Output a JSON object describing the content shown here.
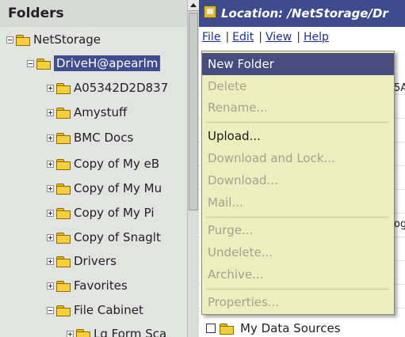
{
  "tree": {
    "title": "Folders",
    "items": [
      {
        "label": "NetStorage",
        "state": "minus"
      },
      {
        "label": "DriveH@apearlm",
        "state": "minus"
      },
      {
        "label": "A05342D2D837",
        "state": "plus"
      },
      {
        "label": "Amystuff",
        "state": "plus"
      },
      {
        "label": "BMC Docs",
        "state": "plus"
      },
      {
        "label": "Copy of My eB",
        "state": "plus"
      },
      {
        "label": "Copy of My Mu",
        "state": "plus"
      },
      {
        "label": "Copy of My Pi",
        "state": "plus"
      },
      {
        "label": "Copy of Snaglt",
        "state": "plus"
      },
      {
        "label": "Drivers",
        "state": "plus"
      },
      {
        "label": "Favorites",
        "state": "plus"
      },
      {
        "label": "File Cabinet",
        "state": "minus"
      },
      {
        "label": "Lg Form Sca",
        "state": "plus"
      }
    ]
  },
  "location": {
    "text": "Location: /NetStorage/Dr"
  },
  "menubar": {
    "file": "File",
    "edit": "Edit",
    "view": "View",
    "help": "Help",
    "separator": "|"
  },
  "file_menu": {
    "items": [
      {
        "label": "New Folder",
        "state": "highlighted"
      },
      {
        "label": "Delete",
        "state": "disabled"
      },
      {
        "label": "Rename...",
        "state": "disabled"
      },
      {
        "label": "Upload...",
        "state": "enabled"
      },
      {
        "label": "Download and Lock...",
        "state": "disabled"
      },
      {
        "label": "Download...",
        "state": "disabled"
      },
      {
        "label": "Mail...",
        "state": "disabled"
      },
      {
        "label": "Purge...",
        "state": "disabled"
      },
      {
        "label": "Undelete...",
        "state": "disabled"
      },
      {
        "label": "Archive...",
        "state": "disabled"
      },
      {
        "label": "Properties...",
        "state": "disabled"
      }
    ]
  },
  "list": {
    "peek_1": "5A",
    "peek_2": "og",
    "bottom_row_label": "My Data Sources"
  },
  "colors": {
    "highlight": "#464d7f",
    "location_bar": "#3e4c8d",
    "menu_background": "#ededbd",
    "folder": "#f5cf3a"
  }
}
